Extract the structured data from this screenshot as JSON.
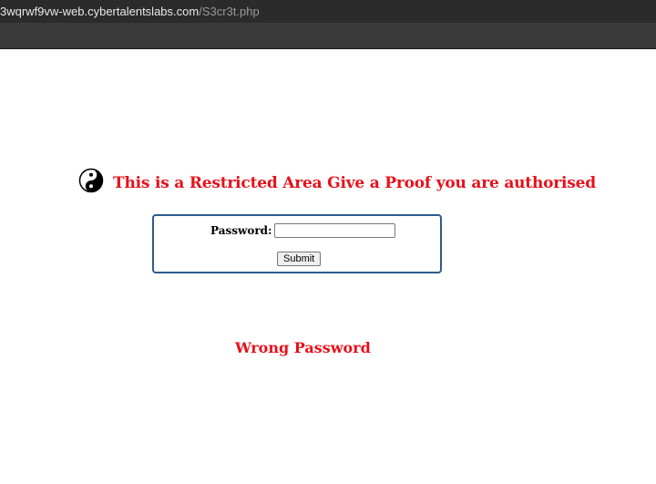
{
  "browser": {
    "url_host": "3wqrwf9vw-web.cybertalentslabs.com",
    "url_path": "/S3cr3t.php"
  },
  "page": {
    "heading_icon": "yin-yang-icon",
    "heading": "This is a Restricted Area Give a Proof you are authorised",
    "password_label": "Password:",
    "password_value": "",
    "submit_label": "Submit",
    "error_message": "Wrong Password"
  },
  "colors": {
    "heading": "#e8101a",
    "form_border": "#2d5d8b",
    "chrome_bar": "#2b2b2b"
  }
}
